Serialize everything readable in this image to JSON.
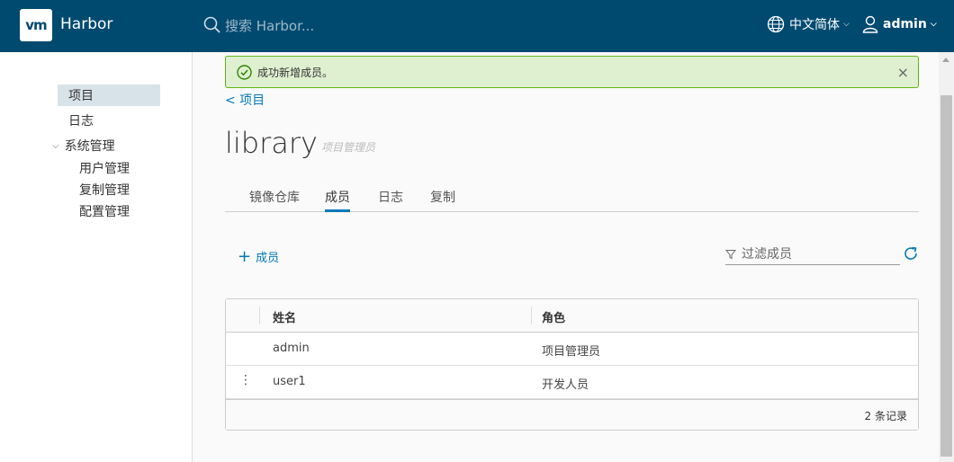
{
  "header": {
    "logo_text": "vm",
    "brand": "Harbor",
    "search_placeholder": "搜索 Harbor...",
    "language": "中文简体",
    "user": "admin"
  },
  "sidebar": {
    "projects": "项目",
    "logs": "日志",
    "admin": "系统管理",
    "sub_items": [
      "用户管理",
      "复制管理",
      "配置管理"
    ]
  },
  "alert": {
    "message": "成功新增成员。",
    "close": "×"
  },
  "breadcrumb": "< 项目",
  "project": {
    "name": "library",
    "role": "项目管理员"
  },
  "tabs": [
    "镜像仓库",
    "成员",
    "日志",
    "复制"
  ],
  "active_tab": "成员",
  "toolbar": {
    "add_member": "成员",
    "filter_placeholder": "过滤成员"
  },
  "table": {
    "columns": [
      "姓名",
      "角色"
    ],
    "rows": [
      {
        "name": "admin",
        "role": "项目管理员"
      },
      {
        "name": "user1",
        "role": "开发人员"
      }
    ],
    "footer": "2 条记录"
  },
  "colors": {
    "header_bg": "#004a70",
    "accent": "#0079b8",
    "success_bg": "#dff0d0",
    "success_border": "#60b515"
  }
}
